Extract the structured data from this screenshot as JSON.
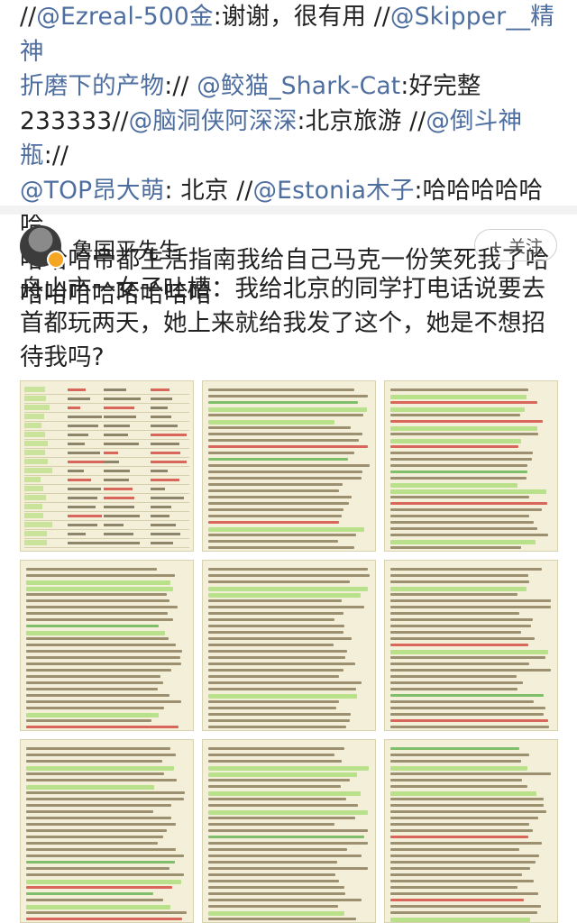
{
  "comments_block": {
    "lines": [
      [
        {
          "t": "//",
          "c": 0
        },
        {
          "t": "@Ezreal-500金",
          "c": 1
        },
        {
          "t": ":谢谢，很有用 //",
          "c": 0
        },
        {
          "t": "@Skipper__精神",
          "c": 1
        }
      ],
      [
        {
          "t": "折磨下的产物",
          "c": 1
        },
        {
          "t": ":// ",
          "c": 0
        },
        {
          "t": "@鲛猫_Shark-Cat",
          "c": 1
        },
        {
          "t": ":好完整",
          "c": 0
        }
      ],
      [
        {
          "t": "233333//",
          "c": 0
        },
        {
          "t": "@脑洞侠阿深深",
          "c": 1
        },
        {
          "t": ":北京旅游 //",
          "c": 0
        },
        {
          "t": "@倒斗神瓶",
          "c": 1
        },
        {
          "t": "://",
          "c": 0
        }
      ],
      [
        {
          "t": "@TOP昂大萌",
          "c": 1
        },
        {
          "t": ": 北京 //",
          "c": 0
        },
        {
          "t": "@Estonia木子",
          "c": 1
        },
        {
          "t": ":哈哈哈哈哈哈",
          "c": 0
        }
      ],
      [
        {
          "t": "哈哈哈帝都生活指南我给自己马克一份笑死我了哈",
          "c": 0
        }
      ],
      [
        {
          "t": "哈哈哈哈哈哈哈哈",
          "c": 0
        }
      ]
    ]
  },
  "post": {
    "author": "鲁国平先生",
    "follow_label": "+ 关注",
    "text": "舟山市一女子吐槽：我给北京的同学打电话说要去首都玩两天，她上来就给我发了这个，她是不想招待我吗?"
  },
  "colors": {
    "mention": "#4e6ea0",
    "card_bg": "#f3efd8",
    "highlight": "#b9e08a",
    "accent_red": "#d9665a"
  },
  "images": {
    "count": 9,
    "items": [
      {
        "name": "attractions-table",
        "kind": "table"
      },
      {
        "name": "attractions-intro",
        "kind": "text"
      },
      {
        "name": "travel-tips",
        "kind": "text"
      },
      {
        "name": "ticket-guide",
        "kind": "text"
      },
      {
        "name": "scenic-intro-2",
        "kind": "text"
      },
      {
        "name": "transport-guide",
        "kind": "text"
      },
      {
        "name": "flight-guide",
        "kind": "text"
      },
      {
        "name": "subway-notes",
        "kind": "text"
      },
      {
        "name": "transport-guide-2",
        "kind": "text"
      }
    ]
  }
}
